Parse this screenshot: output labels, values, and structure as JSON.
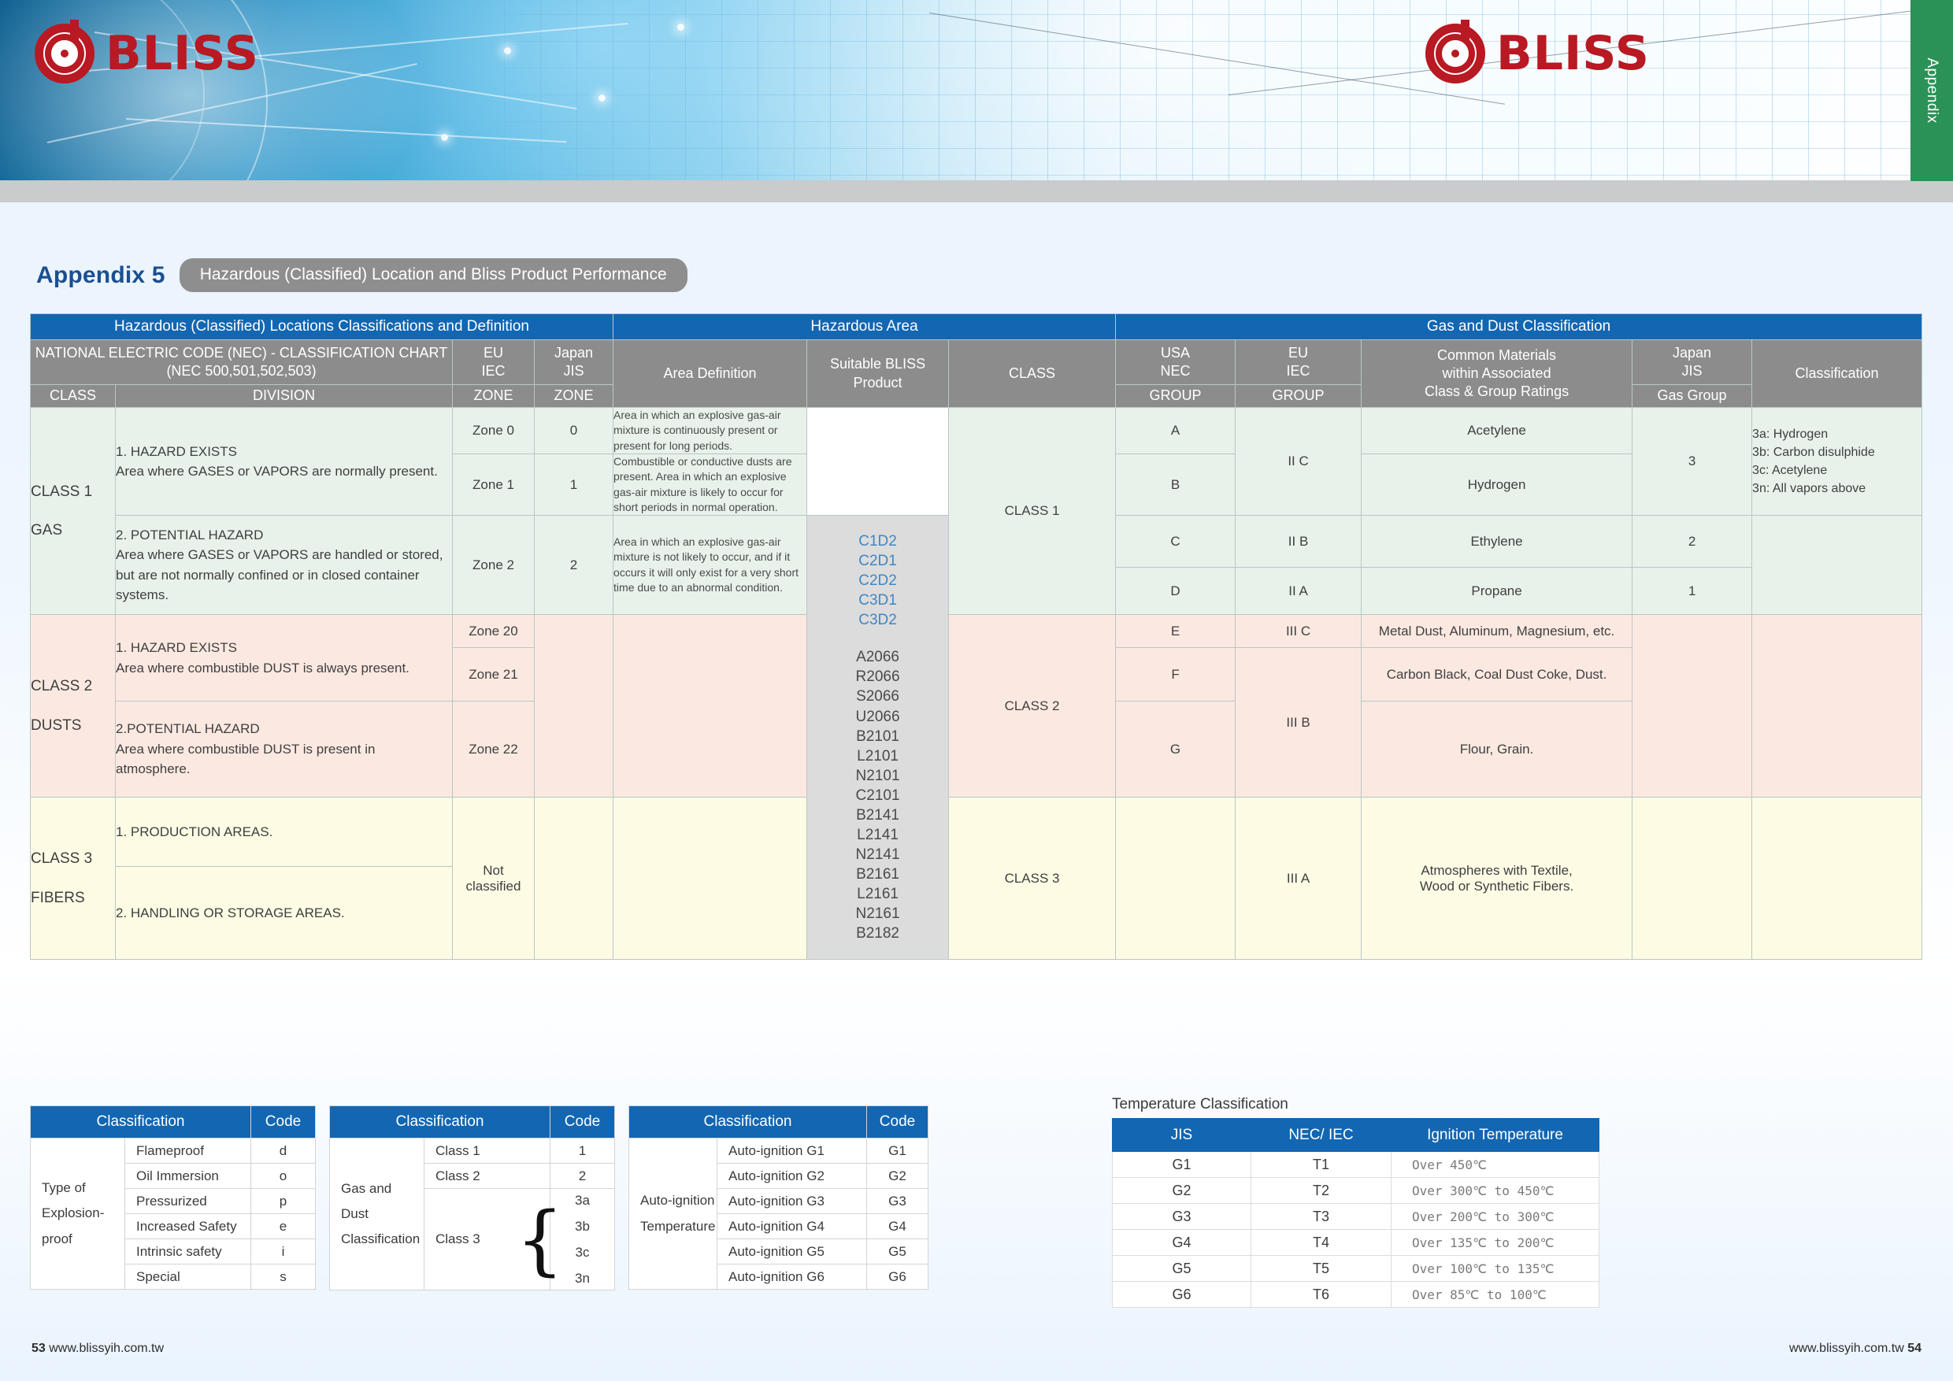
{
  "brand": {
    "name": "BLISS",
    "logo_icon": "bliss-target-logo"
  },
  "appendix_tab": {
    "label": "Appendix"
  },
  "title": {
    "main": "Appendix 5",
    "subtitle": "Hazardous (Classified) Location and Bliss Product Performance"
  },
  "colors": {
    "header_blue": "#1266b2",
    "header_grey": "#8c8c8c",
    "class1_green": "#e8f2ea",
    "class2_pink": "#fbe9e1",
    "class3_cream": "#fdfbe4",
    "product_grey": "#dcdcdc",
    "product_blue_text": "#3f86c8",
    "title_blue": "#1a4f93",
    "tab_green": "#2b9257",
    "logo_red": "#b81922"
  },
  "main_table": {
    "group_headers": [
      "Hazardous (Classified) Locations Classifications and Definition",
      "Hazardous Area",
      "Gas and Dust Classification"
    ],
    "col_headers": {
      "nec_chart": "NATIONAL ELECTRIC CODE (NEC)  -  CLASSIFICATION CHART\n(NEC 500,501,502,503)",
      "nec_chart_l1": "NATIONAL ELECTRIC CODE (NEC)  -  CLASSIFICATION CHART",
      "nec_chart_l2": "(NEC 500,501,502,503)",
      "class": "CLASS",
      "division": "DIVISION",
      "eu_iec": "EU\nIEC",
      "eu_iec_l1": "EU",
      "eu_iec_l2": "IEC",
      "japan_jis": "Japan\nJIS",
      "japan_jis_l1": "Japan",
      "japan_jis_l2": "JIS",
      "zone": "ZONE",
      "area_definition": "Area Definition",
      "suitable_product_l1": "Suitable BLISS",
      "suitable_product_l2": "Product",
      "ha_class": "CLASS",
      "usa_nec_l1": "USA",
      "usa_nec_l2": "NEC",
      "group": "GROUP",
      "common_materials_l1": "Common Materials",
      "common_materials_l2": "within Associated",
      "common_materials_l3": "Class & Group Ratings",
      "gas_group": "Gas Group",
      "classification": "Classification"
    },
    "class1": {
      "class_label": "CLASS  1",
      "class_type": "GAS",
      "division1_title": "1. HAZARD EXISTS",
      "division1_text": "Area where GASES or VAPORS are normally present.",
      "division2_title": "2. POTENTIAL HAZARD",
      "division2_text": "Area where GASES or VAPORS are handled or stored, but are not normally confined or in closed container systems.",
      "zones_eu": [
        "Zone 0",
        "Zone 1",
        "Zone 2"
      ],
      "zones_jis": [
        "0",
        "1",
        "2"
      ],
      "area_def_0": "Area in which an explosive gas-air mixture is continuously present or present for long periods.",
      "area_def_1": "Combustible or conductive dusts are present. Area in which an explosive gas-air mixture is likely to occur for short periods in normal operation.",
      "area_def_2": "Area in which an explosive gas-air mixture is not likely to occur, and if it occurs it will only exist for a very short time due to an abnormal condition.",
      "ha_class": "CLASS  1",
      "groups": [
        "A",
        "B",
        "C",
        "D"
      ],
      "iec_groups": [
        "II C",
        "II B",
        "II A"
      ],
      "materials": [
        "Acetylene",
        "Hydrogen",
        "Ethylene",
        "Propane"
      ],
      "gas_groups": [
        "3",
        "2",
        "1"
      ],
      "classification_notes": [
        "3a: Hydrogen",
        "3b: Carbon disulphide",
        "3c: Acetylene",
        "3n: All vapors above"
      ]
    },
    "class2": {
      "class_label": "CLASS  2",
      "class_type": "DUSTS",
      "division1_title": "1. HAZARD EXISTS",
      "division1_text": "Area where combustible DUST is always present.",
      "division2_title": "2.POTENTIAL HAZARD",
      "division2_text": "Area where combustible DUST is present in atmosphere.",
      "zones_eu": [
        "Zone 20",
        "Zone 21",
        "Zone 22"
      ],
      "ha_class": "CLASS  2",
      "groups": [
        "E",
        "F",
        "G"
      ],
      "iec_groups": [
        "III C",
        "III B"
      ],
      "materials": [
        "Metal Dust, Aluminum, Magnesium, etc.",
        "Carbon Black, Coal Dust Coke, Dust.",
        "Flour, Grain."
      ]
    },
    "class3": {
      "class_label": "CLASS  3",
      "class_type": "FIBERS",
      "division1_text": "1. PRODUCTION AREAS.",
      "division2_text": "2. HANDLING OR STORAGE AREAS.",
      "zone_l1": "Not",
      "zone_l2": "classified",
      "ha_class": "CLASS  3",
      "iec_group": "III A",
      "material_l1": "Atmospheres with Textile,",
      "material_l2": "Wood or Synthetic Fibers."
    },
    "products": {
      "blue": [
        "C1D2",
        "C2D1",
        "C2D2",
        "C3D1",
        "C3D2"
      ],
      "dark": [
        "A2066",
        "R2066",
        "S2066",
        "U2066",
        "B2101",
        "L2101",
        "N2101",
        "C2101",
        "B2141",
        "L2141",
        "N2141",
        "B2161",
        "L2161",
        "N2161",
        "B2182"
      ]
    }
  },
  "table_explosion_proof": {
    "header": {
      "classification": "Classification",
      "code": "Code"
    },
    "row_label_l1": "Type of",
    "row_label_l2": "Explosion-",
    "row_label_l3": "proof",
    "rows": [
      {
        "name": "Flameproof",
        "code": "d"
      },
      {
        "name": "Oil Immersion",
        "code": "o"
      },
      {
        "name": "Pressurized",
        "code": "p"
      },
      {
        "name": "Increased Safety",
        "code": "e"
      },
      {
        "name": "Intrinsic safety",
        "code": "i"
      },
      {
        "name": "Special",
        "code": "s"
      }
    ]
  },
  "table_gas_dust": {
    "header": {
      "classification": "Classification",
      "code": "Code"
    },
    "row_label_l1": "Gas and",
    "row_label_l2": "Dust",
    "row_label_l3": "Classification",
    "rows": [
      {
        "name": "Class  1",
        "code": "1"
      },
      {
        "name": "Class 2",
        "code": "2"
      }
    ],
    "class3_name": "Class 3",
    "class3_codes": [
      "3a",
      "3b",
      "3c",
      "3n"
    ]
  },
  "table_autoignition": {
    "header": {
      "classification": "Classification",
      "code": "Code"
    },
    "row_label_l1": "Auto-ignition",
    "row_label_l2": "Temperature",
    "rows": [
      {
        "name": "Auto-ignition G1",
        "code": "G1"
      },
      {
        "name": "Auto-ignition G2",
        "code": "G2"
      },
      {
        "name": "Auto-ignition G3",
        "code": "G3"
      },
      {
        "name": "Auto-ignition G4",
        "code": "G4"
      },
      {
        "name": "Auto-ignition G5",
        "code": "G5"
      },
      {
        "name": "Auto-ignition G6",
        "code": "G6"
      }
    ]
  },
  "table_temperature": {
    "title": "Temperature Classification",
    "headers": [
      "JIS",
      "NEC/ IEC",
      "Ignition Temperature"
    ],
    "rows": [
      {
        "jis": "G1",
        "nec": "T1",
        "temp": "Over  450℃"
      },
      {
        "jis": "G2",
        "nec": "T2",
        "temp": "Over  300℃  to  450℃"
      },
      {
        "jis": "G3",
        "nec": "T3",
        "temp": "Over  200℃  to  300℃"
      },
      {
        "jis": "G4",
        "nec": "T4",
        "temp": "Over  135℃  to  200℃"
      },
      {
        "jis": "G5",
        "nec": "T5",
        "temp": "Over  100℃  to  135℃"
      },
      {
        "jis": "G6",
        "nec": "T6",
        "temp": "Over  85℃  to  100℃"
      }
    ]
  },
  "footer": {
    "left_page": "53",
    "left_url": "www.blissyih.com.tw",
    "right_url": "www.blissyih.com.tw",
    "right_page": "54"
  }
}
